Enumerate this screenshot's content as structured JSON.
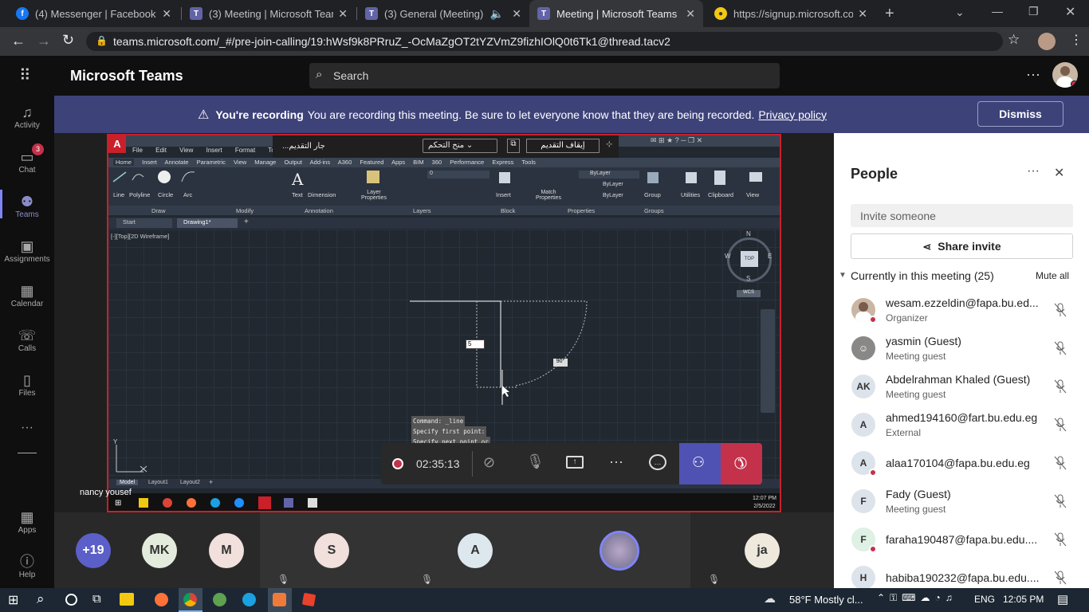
{
  "browser": {
    "tabs": [
      {
        "title": "(4) Messenger | Facebook",
        "color": "#1877f2",
        "glyph": "f"
      },
      {
        "title": "(3) Meeting | Microsoft Team",
        "color": "#6264a7",
        "glyph": "T"
      },
      {
        "title": "(3) General (Meeting) | M",
        "color": "#6264a7",
        "glyph": "T"
      },
      {
        "title": "Meeting | Microsoft Teams",
        "color": "#6264a7",
        "glyph": "T"
      },
      {
        "title": "https://signup.microsoft.com",
        "color": "#f2c811",
        "glyph": "⌘"
      }
    ],
    "url": "teams.microsoft.com/_#/pre-join-calling/19:hWsf9k8PRruZ_-OcMaZgOT2tYZVmZ9fizhIOlQ0t6Tk1@thread.tacv2"
  },
  "teams": {
    "app_title": "Microsoft Teams",
    "search_placeholder": "Search",
    "rail": [
      {
        "label": "Activity",
        "icon": "bell-icon",
        "glyph": "🔔"
      },
      {
        "label": "Chat",
        "icon": "chat-icon",
        "glyph": "💬",
        "badge": "3"
      },
      {
        "label": "Teams",
        "icon": "teams-icon",
        "glyph": "👥"
      },
      {
        "label": "Assignments",
        "icon": "assignments-icon",
        "glyph": "🎒"
      },
      {
        "label": "Calendar",
        "icon": "calendar-icon",
        "glyph": "▦"
      },
      {
        "label": "Calls",
        "icon": "phone-icon",
        "glyph": "☏"
      },
      {
        "label": "Files",
        "icon": "file-icon",
        "glyph": "▯"
      },
      {
        "label": "Apps",
        "icon": "apps-icon",
        "glyph": "▦"
      },
      {
        "label": "Help",
        "icon": "help-icon",
        "glyph": "?"
      }
    ]
  },
  "banner": {
    "bold": "You're recording",
    "text": "You are recording this meeting. Be sure to let everyone know that they are being recorded.",
    "link": "Privacy policy",
    "dismiss": "Dismiss"
  },
  "share": {
    "presenter": "nancy yousef",
    "controls_title": "...جار التقديم",
    "controls_dropdown": "منح التحكم",
    "stop_label": "إيقاف التقديم",
    "acad_menu": [
      "File",
      "Edit",
      "View",
      "Insert",
      "Format",
      "Tools"
    ],
    "acad_tabs": [
      "Home",
      "Insert",
      "Annotate",
      "Parametric",
      "View",
      "Manage",
      "Output",
      "Add-ins",
      "A360",
      "Featured Apps",
      "BIM 360",
      "Performance",
      "Express Tools"
    ],
    "ribbon_tools": [
      "Line",
      "Polyline",
      "Circle",
      "Arc",
      "Text",
      "Dimension",
      "Layer Properties",
      "Insert",
      "Match Properties",
      "Group",
      "Utilities",
      "Clipboard",
      "View"
    ],
    "ribbon_panels": [
      "Draw",
      "Modify",
      "Annotation",
      "Layers",
      "Block",
      "Properties",
      "Groups"
    ],
    "layer_value": "0",
    "bylayer": [
      "ByLayer",
      "ByLayer",
      "ByLayer"
    ],
    "doc_tabs": [
      "Start",
      "Drawing1*"
    ],
    "viewport_label": "[-][Top][2D Wireframe]",
    "viewcube": {
      "n": "N",
      "s": "S",
      "e": "E",
      "w": "W",
      "top": "TOP",
      "wcs": "WCS"
    },
    "dim_input": "5",
    "angle_tip": "90°",
    "command_lines": [
      "Command: _line",
      "Specify first point:",
      "Specify next point or"
    ],
    "layout_tabs": [
      "Model",
      "Layout1",
      "Layout2"
    ],
    "remote_clock": "12:07 PM",
    "remote_date": "2/5/2022",
    "ucs_y": "Y"
  },
  "call_controls": {
    "timer": "02:35:13"
  },
  "people": {
    "title": "People",
    "invite_placeholder": "Invite someone",
    "share_invite": "Share invite",
    "section": "Currently in this meeting (25)",
    "mute_all": "Mute all",
    "list": [
      {
        "name": "wesam.ezzeldin@fapa.bu.ed...",
        "role": "Organizer",
        "initials": "",
        "bg": "#c9b6a4",
        "photo": true,
        "dot": true
      },
      {
        "name": "yasmin (Guest)",
        "role": "Meeting guest",
        "initials": "",
        "bg": "#8a8886",
        "guest": true
      },
      {
        "name": "Abdelrahman Khaled (Guest)",
        "role": "Meeting guest",
        "initials": "AK",
        "bg": "#dde3ea"
      },
      {
        "name": "ahmed194160@fart.bu.edu.eg",
        "role": "External",
        "initials": "A",
        "bg": "#dde3ea"
      },
      {
        "name": "alaa170104@fapa.bu.edu.eg",
        "role": "",
        "initials": "A",
        "bg": "#dde3ea",
        "dot": true
      },
      {
        "name": "Fady (Guest)",
        "role": "Meeting guest",
        "initials": "F",
        "bg": "#dde3ea"
      },
      {
        "name": "faraha190487@fapa.bu.edu....",
        "role": "",
        "initials": "F",
        "bg": "#dff0e4",
        "dot": true
      },
      {
        "name": "habiba190232@fapa.bu.edu....",
        "role": "",
        "initials": "H",
        "bg": "#dde3ea",
        "dot": true
      }
    ]
  },
  "gallery": [
    {
      "label": "+19",
      "bg": "#5b5fc7",
      "fg": "#fff"
    },
    {
      "label": "MK",
      "bg": "#e3ecdc",
      "fg": "#333"
    },
    {
      "label": "M",
      "bg": "#f1e0dc",
      "fg": "#333"
    },
    {
      "label": "S",
      "bg": "#f1e0dc",
      "fg": "#333"
    },
    {
      "label": "A",
      "bg": "#dde8ee",
      "fg": "#333"
    },
    {
      "label": "",
      "bg": "#8f8fa8",
      "fg": "#fff",
      "photo": true
    },
    {
      "label": "ja",
      "bg": "#efe8dd",
      "fg": "#333"
    }
  ],
  "taskbar": {
    "weather": "58°F  Mostly cl...",
    "lang": "ENG",
    "time": "12:05 PM"
  },
  "colors": {
    "accent": "#6264a7",
    "banner": "#3d4279",
    "hangup": "#c4314b",
    "recording_border": "#c9202a"
  }
}
